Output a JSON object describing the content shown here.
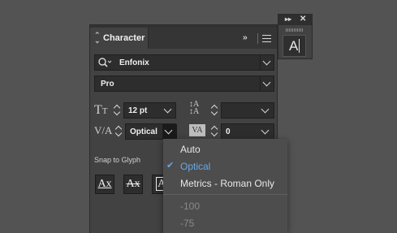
{
  "panel": {
    "tab_label": "Character",
    "font_family": "Enfonix",
    "font_style": "Pro",
    "font_size": "12 pt",
    "leading": "",
    "kerning": "Optical",
    "tracking": "0",
    "snap_label": "Snap to Glyph",
    "snap_buttons": [
      "Ax",
      "Ax",
      "A"
    ]
  },
  "mini_panel": {
    "glyph": "A"
  },
  "kerning_menu": {
    "items": [
      {
        "label": "Auto",
        "state": "normal"
      },
      {
        "label": "Optical",
        "state": "selected"
      },
      {
        "label": "Metrics - Roman Only",
        "state": "normal"
      },
      {
        "label": "-100",
        "state": "disabled"
      },
      {
        "label": "-75",
        "state": "disabled"
      }
    ]
  },
  "icons": {
    "tab_chevron": "collapse-chevron-icon",
    "collapse": "double-chevron-right-icon",
    "menu": "hamburger-menu-icon",
    "search": "magnifier-icon",
    "check": "checkmark-icon"
  },
  "colors": {
    "background": "#535353",
    "panel": "#424242",
    "field": "#2d2d2d",
    "menu": "#4d4d4d",
    "selected": "#68a8e8"
  }
}
